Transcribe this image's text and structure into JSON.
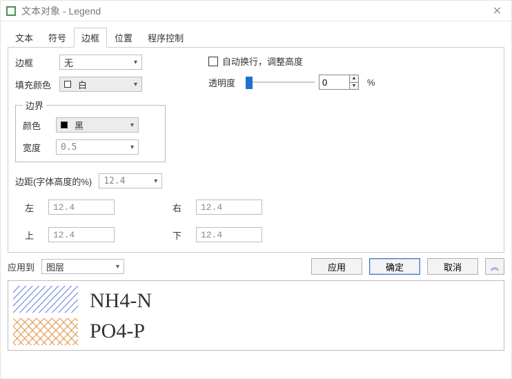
{
  "window": {
    "title": "文本对象 - Legend"
  },
  "tabs": [
    "文本",
    "符号",
    "边框",
    "位置",
    "程序控制"
  ],
  "active_tab_index": 2,
  "border_panel": {
    "border_label": "边框",
    "border_value": "无",
    "fill_label": "填充颜色",
    "fill_value": "白",
    "auto_wrap_label": "自动换行，调整高度",
    "opacity_label": "透明度",
    "opacity_value": "0",
    "opacity_suffix": "%",
    "boundary_legend": "边界",
    "color_label": "颜色",
    "color_value": "黑",
    "width_label": "宽度",
    "width_value": "0.5",
    "margin_caption": "边距(字体高度的%)",
    "margin_overall": "12.4",
    "left_label": "左",
    "left_value": "12.4",
    "right_label": "右",
    "right_value": "12.4",
    "top_label": "上",
    "top_value": "12.4",
    "bottom_label": "下",
    "bottom_value": "12.4"
  },
  "bottom": {
    "apply_to_label": "应用到",
    "apply_to_value": "图层",
    "apply": "应用",
    "ok": "确定",
    "cancel": "取消",
    "expand": "«"
  },
  "legend_preview": {
    "items": [
      {
        "label": "NH4-N",
        "pattern": "diag-blue"
      },
      {
        "label": "PO4-P",
        "pattern": "cross-orange"
      }
    ]
  }
}
